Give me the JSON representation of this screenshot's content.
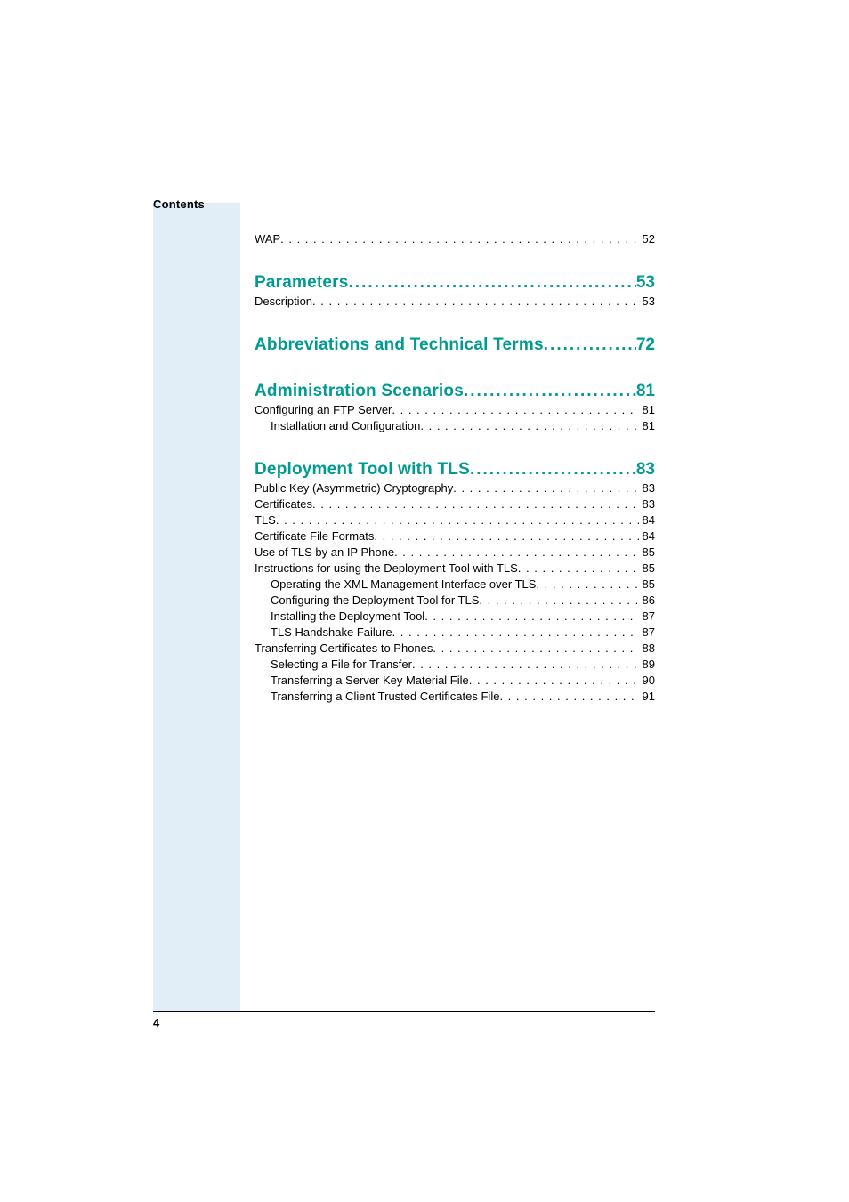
{
  "header": {
    "label": "Contents"
  },
  "page_number": "4",
  "toc": [
    {
      "kind": "entry",
      "label": "WAP",
      "page": "52",
      "indent": 0,
      "gap": "first"
    },
    {
      "kind": "chapter",
      "label": "Parameters",
      "page": "53",
      "gap": "chapter"
    },
    {
      "kind": "entry",
      "label": "Description",
      "page": "53",
      "indent": 0
    },
    {
      "kind": "chapter",
      "label": "Abbreviations and Technical Terms",
      "page": "72",
      "gap": "chapter"
    },
    {
      "kind": "chapter",
      "label": "Administration Scenarios",
      "page": "81",
      "gap": "chapter"
    },
    {
      "kind": "entry",
      "label": "Configuring an FTP Server",
      "page": "81",
      "indent": 0
    },
    {
      "kind": "entry",
      "label": "Installation and Configuration",
      "page": "81",
      "indent": 1
    },
    {
      "kind": "chapter",
      "label": "Deployment Tool with TLS",
      "page": "83",
      "gap": "chapter"
    },
    {
      "kind": "entry",
      "label": "Public Key (Asymmetric) Cryptography",
      "page": "83",
      "indent": 0
    },
    {
      "kind": "entry",
      "label": "Certificates",
      "page": "83",
      "indent": 0
    },
    {
      "kind": "entry",
      "label": "TLS",
      "page": "84",
      "indent": 0
    },
    {
      "kind": "entry",
      "label": "Certificate File Formats",
      "page": "84",
      "indent": 0
    },
    {
      "kind": "entry",
      "label": "Use of TLS by an IP Phone",
      "page": "85",
      "indent": 0
    },
    {
      "kind": "entry",
      "label": "Instructions for using the Deployment Tool with TLS",
      "page": "85",
      "indent": 0
    },
    {
      "kind": "entry",
      "label": "Operating the XML Management Interface over TLS",
      "page": "85",
      "indent": 1
    },
    {
      "kind": "entry",
      "label": "Configuring the Deployment Tool for TLS",
      "page": "86",
      "indent": 1
    },
    {
      "kind": "entry",
      "label": "Installing the Deployment Tool",
      "page": "87",
      "indent": 1
    },
    {
      "kind": "entry",
      "label": "TLS Handshake Failure",
      "page": "87",
      "indent": 1
    },
    {
      "kind": "entry",
      "label": "Transferring Certificates to Phones",
      "page": "88",
      "indent": 0
    },
    {
      "kind": "entry",
      "label": "Selecting a File for Transfer",
      "page": "89",
      "indent": 1
    },
    {
      "kind": "entry",
      "label": "Transferring a Server Key Material File",
      "page": "90",
      "indent": 1
    },
    {
      "kind": "entry",
      "label": "Transferring a Client Trusted Certificates File",
      "page": "91",
      "indent": 1
    }
  ]
}
